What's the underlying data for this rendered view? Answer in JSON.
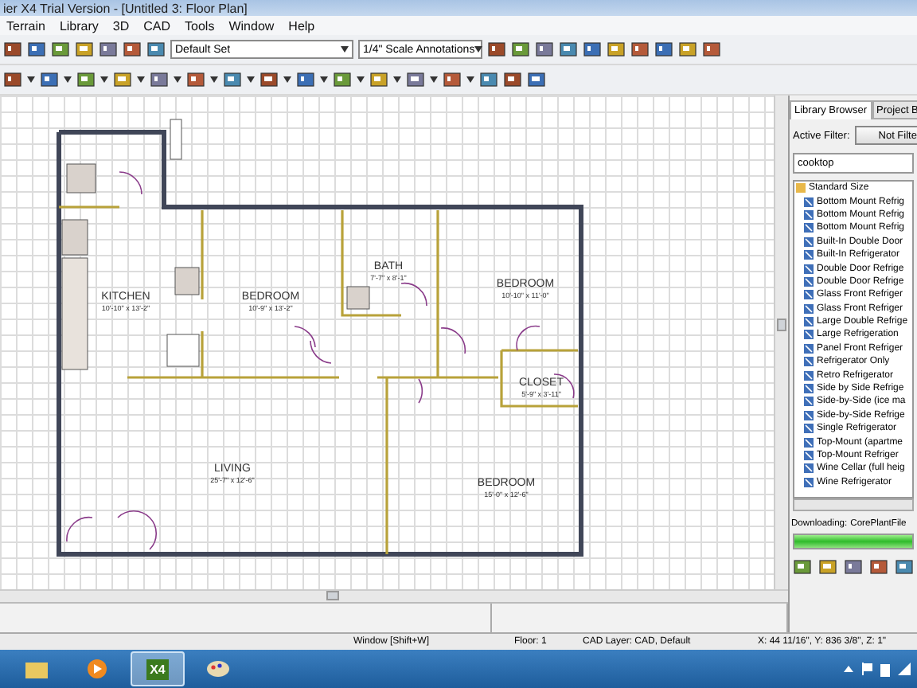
{
  "window": {
    "title": "ier X4 Trial Version - [Untitled 3: Floor Plan]"
  },
  "menu": [
    "Terrain",
    "Library",
    "3D",
    "CAD",
    "Tools",
    "Window",
    "Help"
  ],
  "toolbar": {
    "layer_set": "Default Set",
    "annotation_set": "1/4\" Scale Annotations"
  },
  "floor_plan": {
    "rooms": [
      {
        "name": "KITCHEN",
        "size": "10'-10\" x 13'-2\""
      },
      {
        "name": "BEDROOM",
        "size": "10'-9\" x 13'-2\""
      },
      {
        "name": "BATH",
        "size": "7'-7\" x 8'-1\""
      },
      {
        "name": "BEDROOM",
        "size": "10'-10\" x 11'-0\""
      },
      {
        "name": "CLOSET",
        "size": "5'-9\" x 3'-11\""
      },
      {
        "name": "LIVING",
        "size": "25'-7\" x 12'-6\""
      },
      {
        "name": "BEDROOM",
        "size": "15'-0\" x 12'-6\""
      }
    ]
  },
  "library": {
    "tabs": [
      {
        "label": "Library Browser",
        "selected": true
      },
      {
        "label": "Project B",
        "selected": false
      }
    ],
    "filter_label": "Active Filter:",
    "filter_button": "Not Filte",
    "search": "cooktop",
    "tree": {
      "label": "Standard Size",
      "expanded": true,
      "children": [
        {
          "label": "Bottom Mount Refrig"
        },
        {
          "label": "Bottom Mount Refrig"
        },
        {
          "label": "Bottom Mount Refrig"
        },
        {
          "label": "Built-In Double Door"
        },
        {
          "label": "Built-In Refrigerator"
        },
        {
          "label": "Double Door Refrige"
        },
        {
          "label": "Double Door Refrige"
        },
        {
          "label": "Glass Front Refriger"
        },
        {
          "label": "Glass Front Refriger"
        },
        {
          "label": "Large Double Refrige"
        },
        {
          "label": "Large Refrigeration"
        },
        {
          "label": "Panel Front Refriger"
        },
        {
          "label": "Refrigerator Only"
        },
        {
          "label": "Retro Refrigerator"
        },
        {
          "label": "Side by Side Refrige"
        },
        {
          "label": "Side-by-Side (ice ma"
        },
        {
          "label": "Side-by-Side Refrige"
        },
        {
          "label": "Single Refrigerator"
        },
        {
          "label": "Top-Mount (apartme"
        },
        {
          "label": "Top-Mount Refriger"
        },
        {
          "label": "Wine Cellar (full heig"
        },
        {
          "label": "Wine Refrigerator"
        }
      ]
    },
    "download_label": "Downloading:",
    "download_file": "CorePlantFile",
    "download": {
      "level": 1
    }
  },
  "status_bar": [
    "Window [Shift+W]",
    "Floor: 1",
    "CAD Layer: CAD,  Default",
    "X: 44 11/16\", Y: 836 3/8\", Z: 1\""
  ],
  "taskbar": {
    "apps": [
      {
        "kind": "folder",
        "selected": false
      },
      {
        "kind": "media",
        "selected": false
      },
      {
        "kind": "x4",
        "label": "X4",
        "selected": true
      },
      {
        "kind": "paint",
        "selected": false
      }
    ]
  }
}
